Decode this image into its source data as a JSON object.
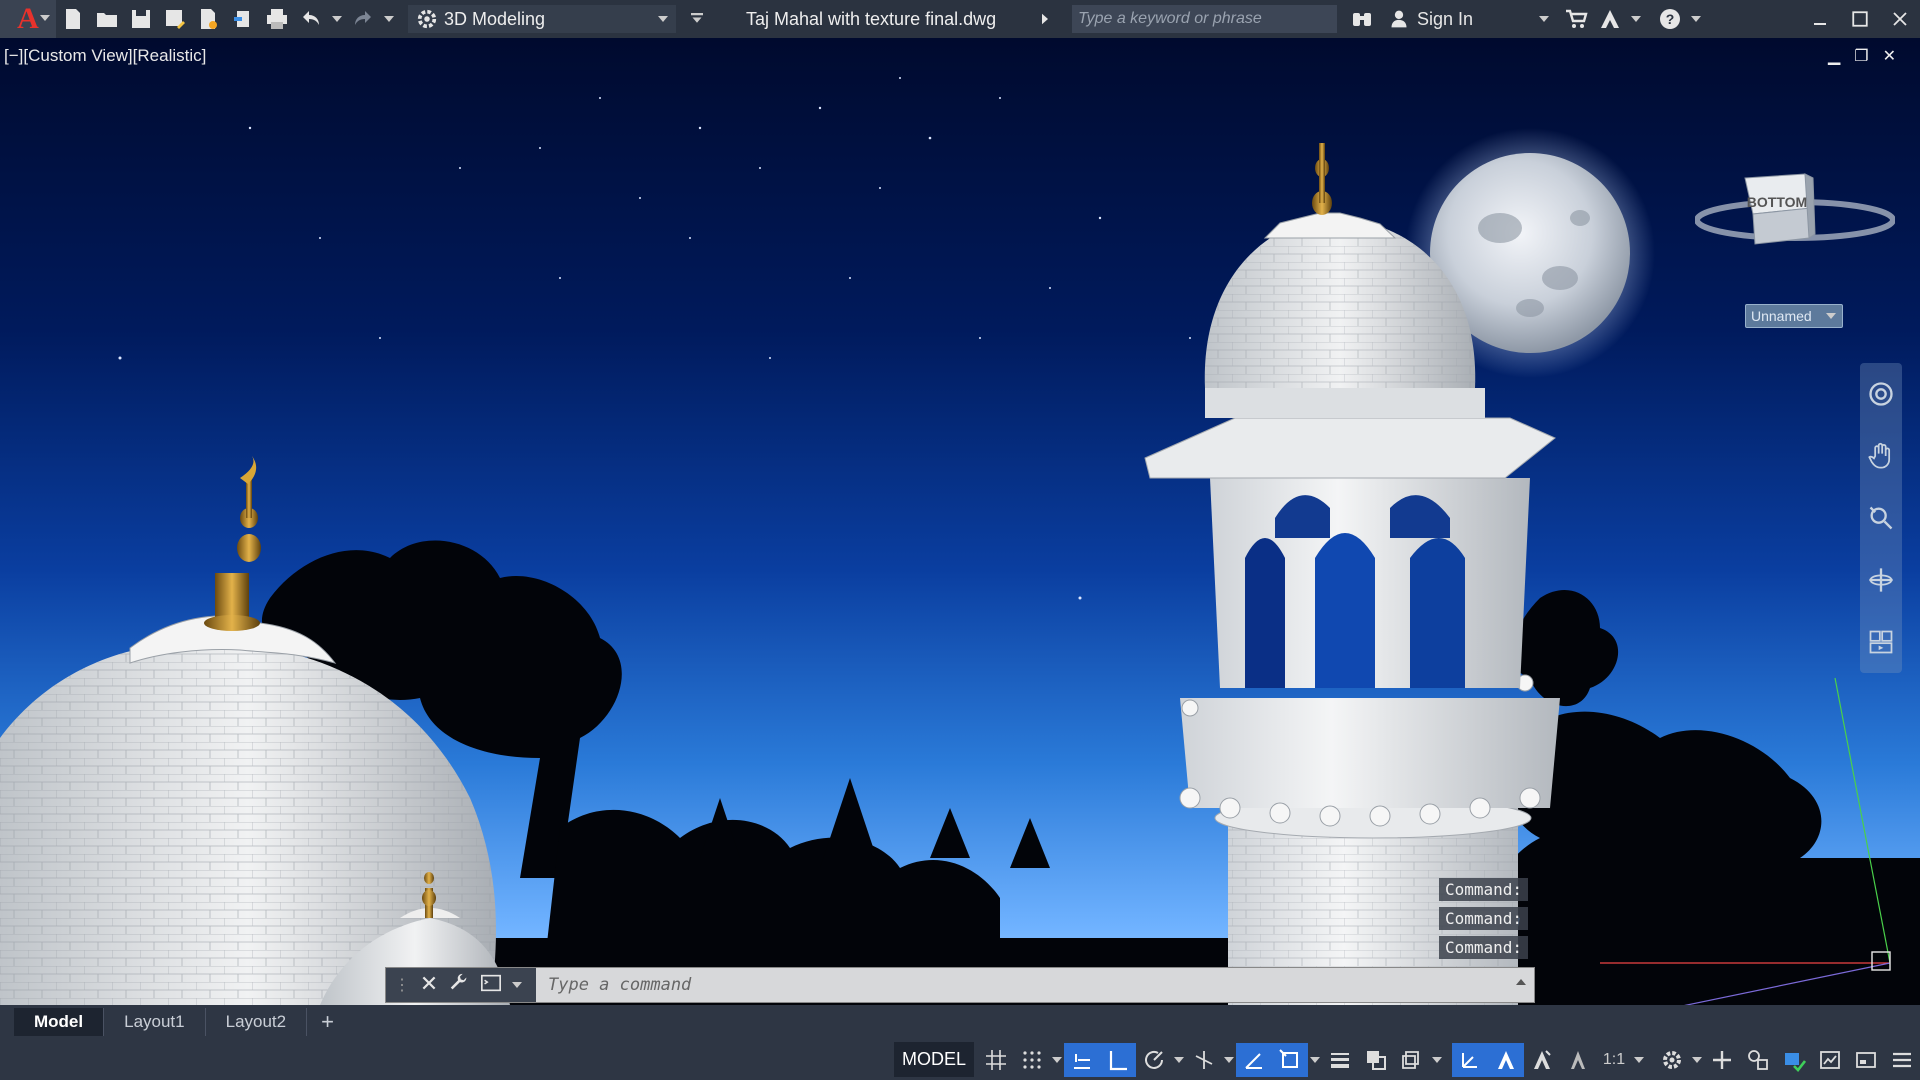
{
  "app": {
    "icon": "autocad-logo",
    "quick_access": [
      "new-icon",
      "open-icon",
      "save-icon",
      "save-as-icon",
      "open-web-icon",
      "save-web-icon",
      "plot-icon",
      "undo-icon",
      "redo-icon"
    ],
    "workspace": "3D Modeling",
    "document_title": "Taj Mahal with texture final.dwg",
    "search_placeholder": "Type a keyword or phrase",
    "sign_in": "Sign In"
  },
  "viewport": {
    "label": "[−][Custom View][Realistic]",
    "viewcube_face": "BOTTOM",
    "ucs_name": "Unnamed",
    "command_history": [
      "Command:",
      "Command:",
      "Command:"
    ],
    "command_placeholder": "Type a command"
  },
  "tabs": [
    "Model",
    "Layout1",
    "Layout2"
  ],
  "status": {
    "model": "MODEL",
    "scale": "1:1"
  },
  "colors": {
    "title_bar": "#2b3340",
    "accent": "#2c6fd4",
    "logo": "#e8322c"
  }
}
